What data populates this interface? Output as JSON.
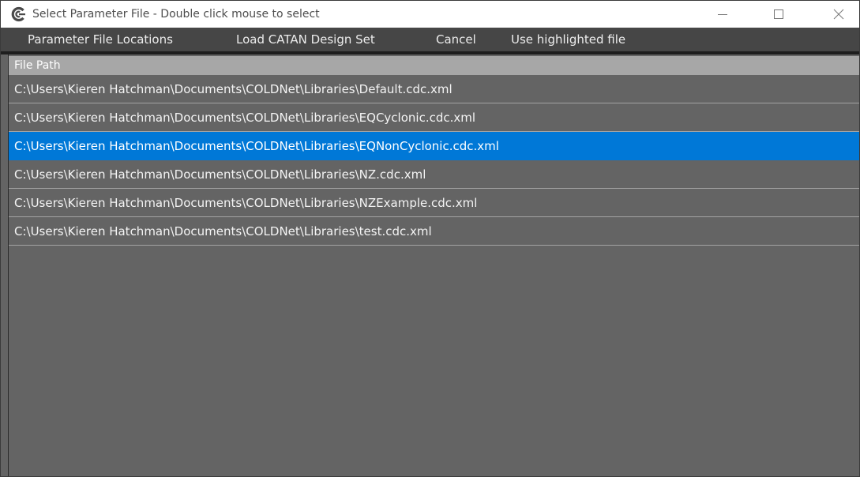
{
  "window": {
    "title": "Select Parameter File - Double click mouse to select"
  },
  "menu": {
    "items": [
      {
        "label": "Parameter File Locations"
      },
      {
        "label": "Load CATAN Design Set"
      },
      {
        "label": "Cancel"
      },
      {
        "label": "Use highlighted file"
      }
    ]
  },
  "list": {
    "header": "File Path",
    "selected_index": 2,
    "rows": [
      {
        "path": "C:\\Users\\Kieren Hatchman\\Documents\\COLDNet\\Libraries\\Default.cdc.xml"
      },
      {
        "path": "C:\\Users\\Kieren Hatchman\\Documents\\COLDNet\\Libraries\\EQCyclonic.cdc.xml"
      },
      {
        "path": "C:\\Users\\Kieren Hatchman\\Documents\\COLDNet\\Libraries\\EQNonCyclonic.cdc.xml"
      },
      {
        "path": "C:\\Users\\Kieren Hatchman\\Documents\\COLDNet\\Libraries\\NZ.cdc.xml"
      },
      {
        "path": "C:\\Users\\Kieren Hatchman\\Documents\\COLDNet\\Libraries\\NZExample.cdc.xml"
      },
      {
        "path": "C:\\Users\\Kieren Hatchman\\Documents\\COLDNet\\Libraries\\test.cdc.xml"
      }
    ]
  },
  "colors": {
    "selection": "#0078d7",
    "background": "#646464",
    "menubar": "#464646",
    "header": "#a7a7a7"
  },
  "icons": {
    "app": "app-logo-icon",
    "minimize": "minimize-icon",
    "maximize": "maximize-icon",
    "close": "close-icon"
  }
}
